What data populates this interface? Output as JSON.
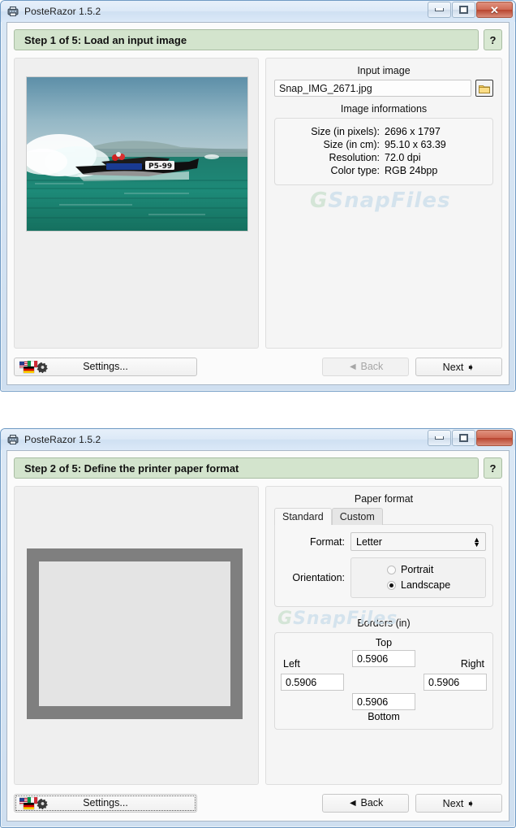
{
  "windows": [
    {
      "title": "PosteRazor 1.5.2",
      "step_banner": "Step 1 of 5: Load an input image",
      "help_label": "?",
      "caption": {
        "minimize": "minimize-button",
        "maximize": "maximize-button",
        "close": "✕"
      },
      "input_image": {
        "group_label": "Input image",
        "value": "Snap_IMG_2671.jpg",
        "placeholder": "Snap_IMG_2671.jpg",
        "browse_icon": "folder-icon"
      },
      "image_info": {
        "group_label": "Image informations",
        "rows": [
          {
            "label": "Size (in pixels):",
            "value": "2696 x 1797"
          },
          {
            "label": "Size (in cm):",
            "value": "95.10 x 63.39"
          },
          {
            "label": "Resolution:",
            "value": "72.0 dpi"
          },
          {
            "label": "Color type:",
            "value": "RGB 24bpp"
          }
        ]
      },
      "buttons": {
        "settings": "Settings...",
        "back": "◄ Back",
        "next": "Next ➧"
      },
      "watermark": {
        "g": "G",
        "text": "SnapFiles"
      }
    },
    {
      "title": "PosteRazor 1.5.2",
      "step_banner": "Step 2 of 5: Define the printer paper format",
      "help_label": "?",
      "paper_format": {
        "group_label": "Paper format",
        "tabs": [
          {
            "label": "Standard",
            "active": true
          },
          {
            "label": "Custom",
            "active": false
          }
        ],
        "format_label": "Format:",
        "format_value": "Letter",
        "orientation_label": "Orientation:",
        "orientation_options": [
          {
            "label": "Portrait",
            "selected": false
          },
          {
            "label": "Landscape",
            "selected": true
          }
        ]
      },
      "borders": {
        "group_label": "Borders (in)",
        "top_label": "Top",
        "top_value": "0.5906",
        "left_label": "Left",
        "left_value": "0.5906",
        "right_label": "Right",
        "right_value": "0.5906",
        "bottom_label": "Bottom",
        "bottom_value": "0.5906"
      },
      "buttons": {
        "settings": "Settings...",
        "back": "◄ Back",
        "next": "Next ➧"
      },
      "watermark": {
        "g": "G",
        "text": "SnapFiles"
      }
    }
  ],
  "colors": {
    "banner_green": "#d3e4cd",
    "window_border_blue": "#6f9ac4",
    "close_red": "#cf6a54",
    "paper_gray": "#7f7f7f",
    "paper_inner_gray": "#e4e4e4"
  }
}
